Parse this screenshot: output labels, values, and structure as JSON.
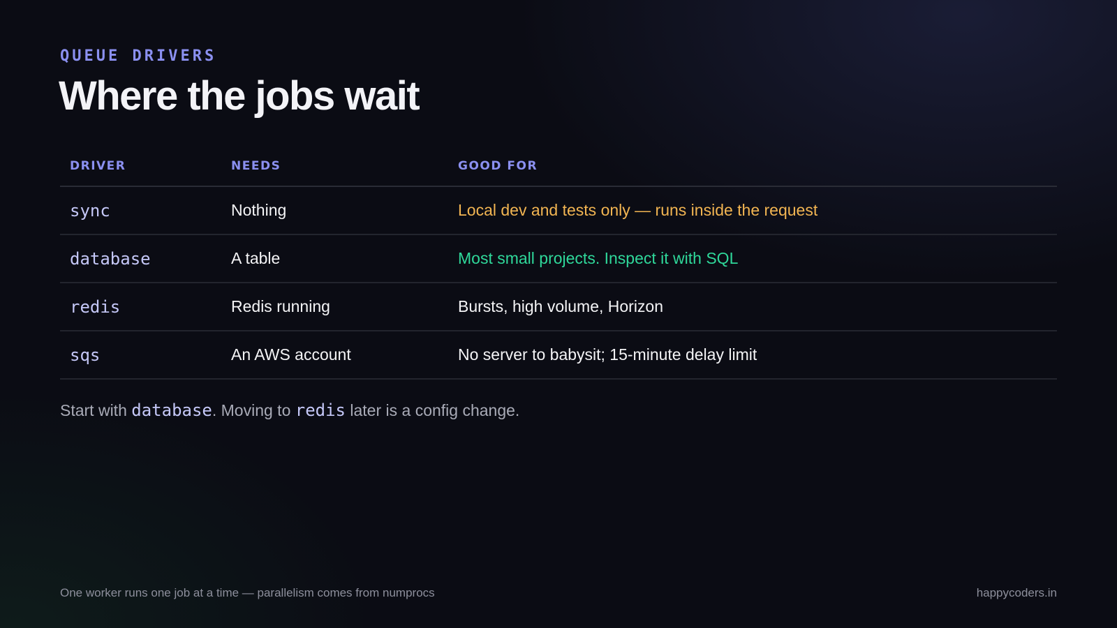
{
  "slide": {
    "eyebrow": "QUEUE DRIVERS",
    "title": "Where the jobs wait"
  },
  "table": {
    "headers": [
      "DRIVER",
      "NEEDS",
      "GOOD FOR"
    ],
    "rows": [
      {
        "driver": "sync",
        "needs": "Nothing",
        "good_for": "Local dev and tests only — runs inside the request",
        "good_for_color": "#f2b552"
      },
      {
        "driver": "database",
        "needs": "A table",
        "good_for": "Most small projects. Inspect it with SQL",
        "good_for_color": "#2fd89a"
      },
      {
        "driver": "redis",
        "needs": "Redis running",
        "good_for": "Bursts, high volume, Horizon",
        "good_for_color": "#f4f4f6"
      },
      {
        "driver": "sqs",
        "needs": "An AWS account",
        "good_for": "No server to babysit; 15-minute delay limit",
        "good_for_color": "#f4f4f6"
      }
    ]
  },
  "footnote": {
    "part1": "Start with ",
    "code1": "database",
    "part2": ". Moving to ",
    "code2": "redis",
    "part3": " later is a config change."
  },
  "footer": {
    "left": "One worker runs one job at a time — parallelism comes from numprocs",
    "right": "happycoders.in"
  },
  "colors": {
    "background": "#0b0c14",
    "accent": "#8b90f0",
    "code": "#c5c8f8",
    "warning": "#f2b552",
    "success": "#2fd89a"
  }
}
